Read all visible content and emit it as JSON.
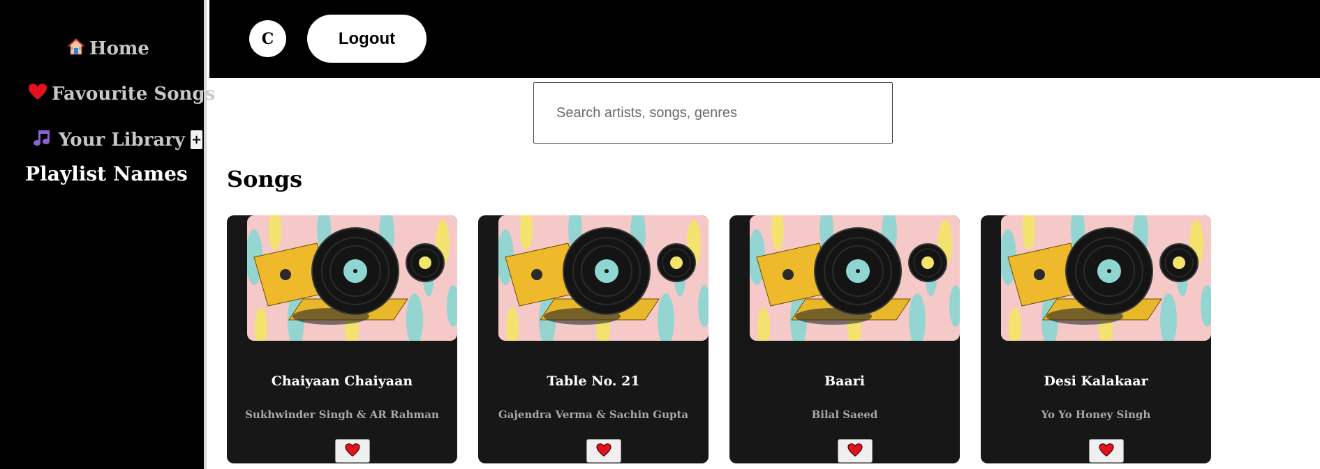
{
  "sidebar": {
    "nav": [
      {
        "label": "Home",
        "icon": "house-icon"
      },
      {
        "label": "Favourite Songs",
        "icon": "heart-icon"
      },
      {
        "label": "Your Library",
        "icon": "music-notes-icon"
      }
    ],
    "add_label": "+",
    "playlist_heading": "Playlist Names"
  },
  "header": {
    "avatar_initial": "C",
    "logout_label": "Logout"
  },
  "search": {
    "placeholder": "Search artists, songs, genres",
    "value": ""
  },
  "songs_section": {
    "title": "Songs",
    "items": [
      {
        "title": "Chaiyaan Chaiyaan",
        "artist": "Sukhwinder Singh & AR Rahman"
      },
      {
        "title": "Table No. 21",
        "artist": "Gajendra Verma & Sachin Gupta"
      },
      {
        "title": "Baari",
        "artist": "Bilal Saeed"
      },
      {
        "title": "Desi Kalakaar",
        "artist": "Yo Yo Honey Singh"
      }
    ]
  },
  "colors": {
    "sidebar_bg": "#000000",
    "topbar_bg": "#000000",
    "card_bg": "#171717",
    "heart": "#e3121e",
    "text_muted": "#a8a8a8"
  }
}
